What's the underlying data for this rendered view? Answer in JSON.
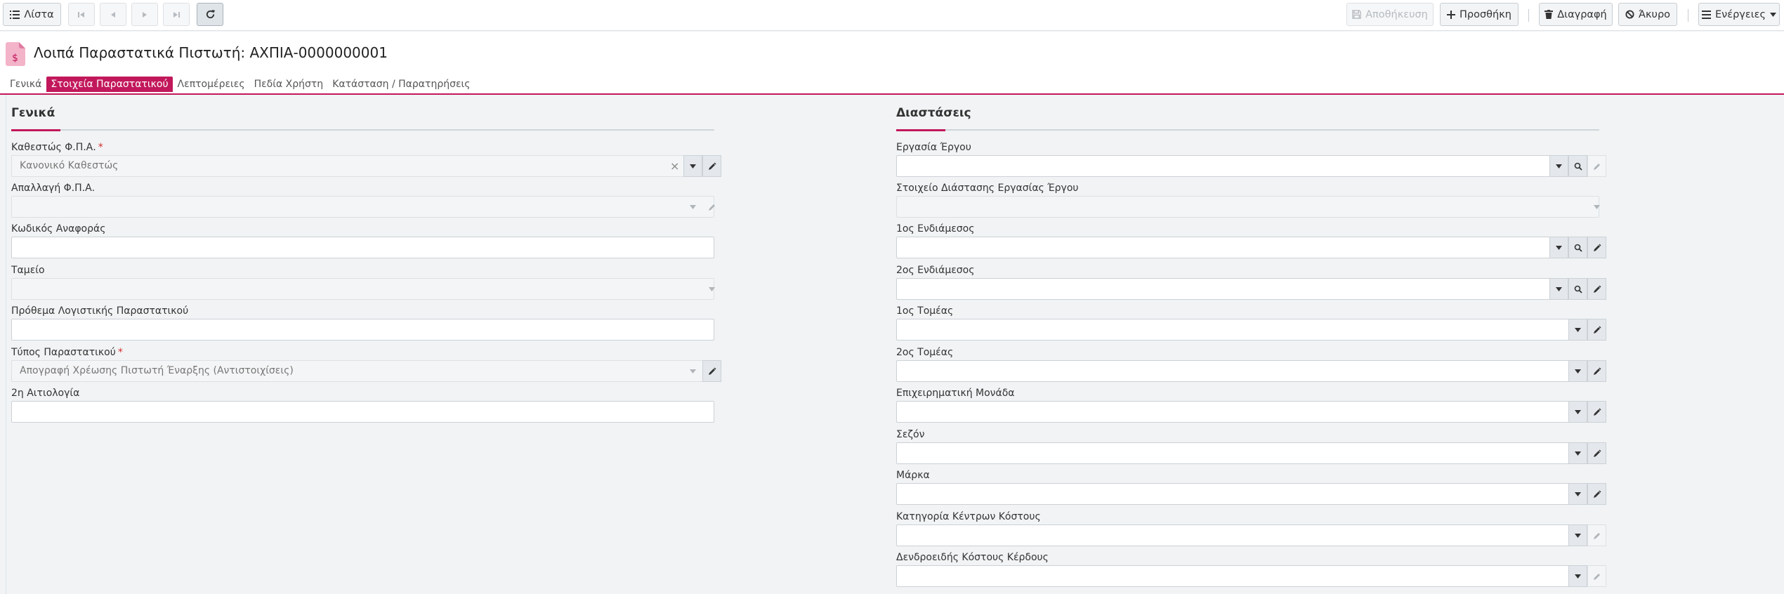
{
  "toolbar": {
    "list_label": "Λίστα",
    "save_label": "Αποθήκευση",
    "add_label": "Προσθήκη",
    "delete_label": "Διαγραφή",
    "cancel_label": "Άκυρο",
    "actions_label": "Ενέργειες"
  },
  "header": {
    "title": "Λοιπά Παραστατικά Πιστωτή: ΑΧΠΙΑ-0000000001",
    "tabs": [
      "Γενικά",
      "Στοιχεία Παραστατικού",
      "Λεπτομέρειες",
      "Πεδία Χρήστη",
      "Κατάσταση / Παρατηρήσεις"
    ]
  },
  "general": {
    "title": "Γενικά",
    "fields": [
      {
        "label": "Καθεστώς Φ.Π.Α.",
        "required": "*",
        "value": "Κανονικό Καθεστώς"
      },
      {
        "label": "Απαλλαγή Φ.Π.Α.",
        "value": ""
      },
      {
        "label": "Κωδικός Αναφοράς",
        "value": ""
      },
      {
        "label": "Ταμείο",
        "value": ""
      },
      {
        "label": "Πρόθεμα Λογιστικής Παραστατικού",
        "value": ""
      },
      {
        "label": "Τύπος Παραστατικού",
        "required": "*",
        "value": "Απογραφή Χρέωσης Πιστωτή Έναρξης (Αντιστοιχίσεις)"
      },
      {
        "label": "2η Αιτιολογία",
        "value": ""
      }
    ]
  },
  "dimensions": {
    "title": "Διαστάσεις",
    "fields": [
      {
        "label": "Εργασία Έργου",
        "value": ""
      },
      {
        "label": "Στοιχείο Διάστασης Εργασίας Έργου",
        "value": ""
      },
      {
        "label": "1ος Ενδιάμεσος",
        "value": ""
      },
      {
        "label": "2ος Ενδιάμεσος",
        "value": ""
      },
      {
        "label": "1ος Τομέας",
        "value": ""
      },
      {
        "label": "2ος Τομέας",
        "value": ""
      },
      {
        "label": "Επιχειρηματική Μονάδα",
        "value": ""
      },
      {
        "label": "Σεζόν",
        "value": ""
      },
      {
        "label": "Μάρκα",
        "value": ""
      },
      {
        "label": "Κατηγορία Κέντρων Κόστους",
        "value": ""
      },
      {
        "label": "Δενδροειδής Κόστους Κέρδους",
        "value": ""
      }
    ]
  }
}
